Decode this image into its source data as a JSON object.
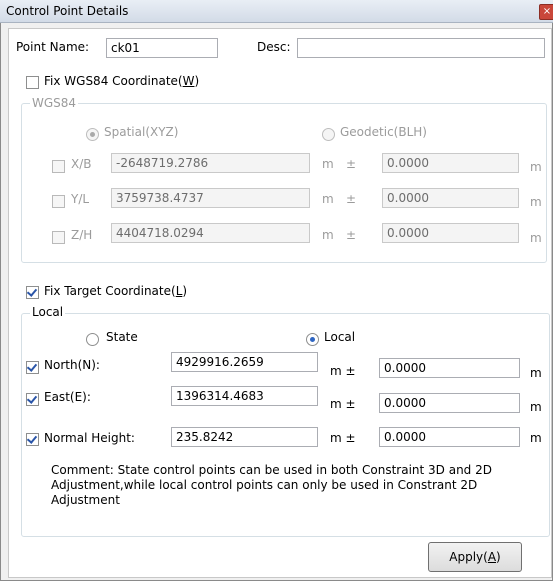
{
  "window": {
    "title": "Control Point Details",
    "close_glyph": "×"
  },
  "header": {
    "point_name_label": "Point Name:",
    "point_name_value": "ck01",
    "desc_label": "Desc:",
    "desc_value": ""
  },
  "wgs84": {
    "fix_checkbox_prefix": "Fix WGS84 Coordinate(",
    "fix_checkbox_key": "W",
    "fix_checkbox_suffix": ")",
    "fix_checked": false,
    "group_title": "WGS84",
    "radio_spatial": "Spatial(XYZ)",
    "radio_geodetic": "Geodetic(BLH)",
    "selected": "spatial",
    "rows": [
      {
        "label": "X/B",
        "value": "-2648719.2786",
        "unit": "m",
        "pm": "±",
        "sigma": "0.0000",
        "sigma_unit": "m",
        "checked": false
      },
      {
        "label": "Y/L",
        "value": "3759738.4737",
        "unit": "m",
        "pm": "±",
        "sigma": "0.0000",
        "sigma_unit": "m",
        "checked": false
      },
      {
        "label": "Z/H",
        "value": "4404718.0294",
        "unit": "m",
        "pm": "±",
        "sigma": "0.0000",
        "sigma_unit": "m",
        "checked": false
      }
    ]
  },
  "target": {
    "fix_checkbox_prefix": "Fix Target Coordinate(",
    "fix_checkbox_key": "L",
    "fix_checkbox_suffix": ")",
    "fix_checked": true,
    "group_title": "Local",
    "radio_state": "State",
    "radio_local": "Local",
    "selected": "local",
    "rows": [
      {
        "label": "North(N):",
        "value": "4929916.2659",
        "unit": "m ±",
        "sigma": "0.0000",
        "sigma_unit": "m",
        "checked": true
      },
      {
        "label": "East(E):",
        "value": "1396314.4683",
        "unit": "m ±",
        "sigma": "0.0000",
        "sigma_unit": "m",
        "checked": true
      },
      {
        "label": "Normal Height:",
        "value": "235.8242",
        "unit": "m ±",
        "sigma": "0.0000",
        "sigma_unit": "m",
        "checked": true
      }
    ],
    "comment_lines": [
      "Comment: State control points can be used in both Constraint 3D and 2D",
      "Adjustment,while local control points can only be used in Constrant 2D",
      "Adjustment"
    ]
  },
  "footer": {
    "apply_prefix": "Apply(",
    "apply_key": "A",
    "apply_suffix": ")"
  },
  "colors": {
    "group_border": "#d5dfe5",
    "title_bar": "#d2dbe7",
    "checkbox_check": "#2a55a8"
  }
}
